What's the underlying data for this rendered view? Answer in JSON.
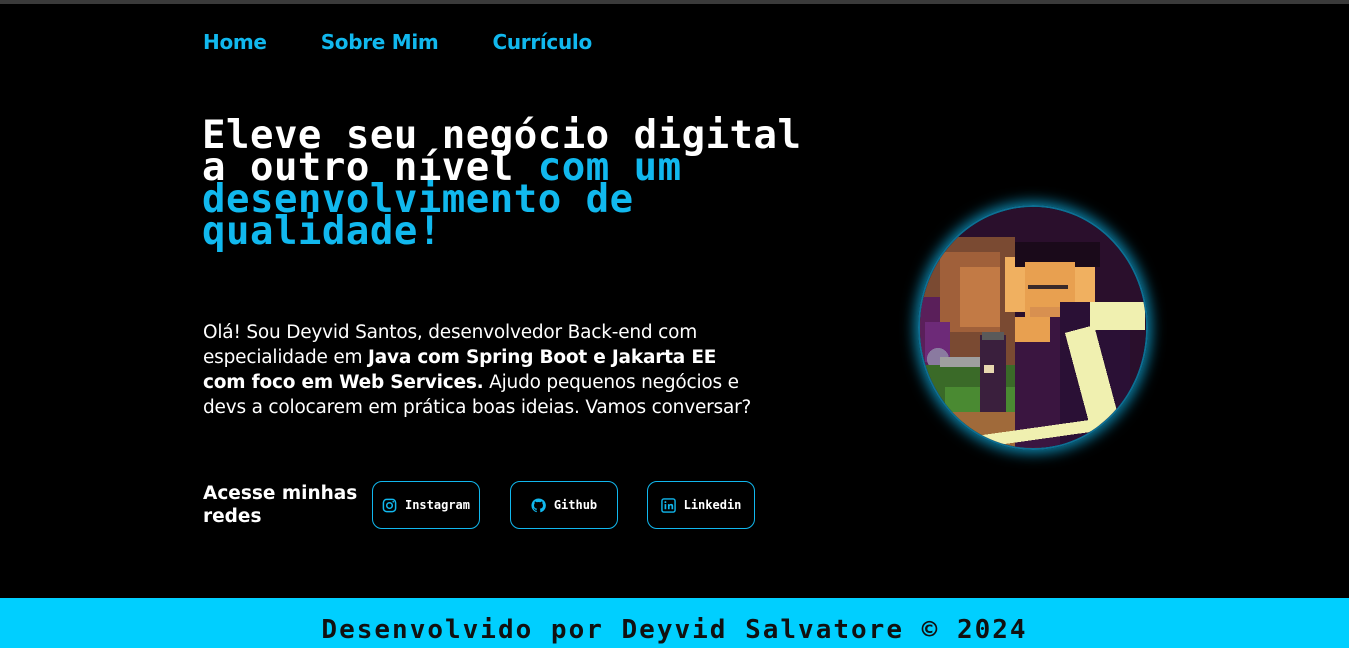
{
  "nav": {
    "items": [
      {
        "label": "Home"
      },
      {
        "label": "Sobre Mim"
      },
      {
        "label": "Currículo"
      }
    ]
  },
  "hero": {
    "headline_white": "Eleve seu negócio digital a outro nível ",
    "headline_accent": "com um desenvolvimento de qualidade!",
    "intro_part1": "Olá! Sou Deyvid Santos, desenvolvedor Back-end com especialidade em ",
    "intro_bold": "Java com Spring Boot e Jakarta EE com foco em Web Services.",
    "intro_part2": " Ajudo pequenos negócios e devs a colocarem em prática boas ideias. Vamos conversar?"
  },
  "social": {
    "title": "Acesse minhas redes",
    "buttons": [
      {
        "label": "Instagram",
        "icon": "instagram-icon"
      },
      {
        "label": "Github",
        "icon": "github-icon"
      },
      {
        "label": "Linkedin",
        "icon": "linkedin-icon"
      }
    ]
  },
  "footer": {
    "text": "Desenvolvido por Deyvid Salvatore © 2024"
  },
  "colors": {
    "accent": "#11b8ee",
    "footer_bg": "#00cfff",
    "background": "#000000"
  }
}
